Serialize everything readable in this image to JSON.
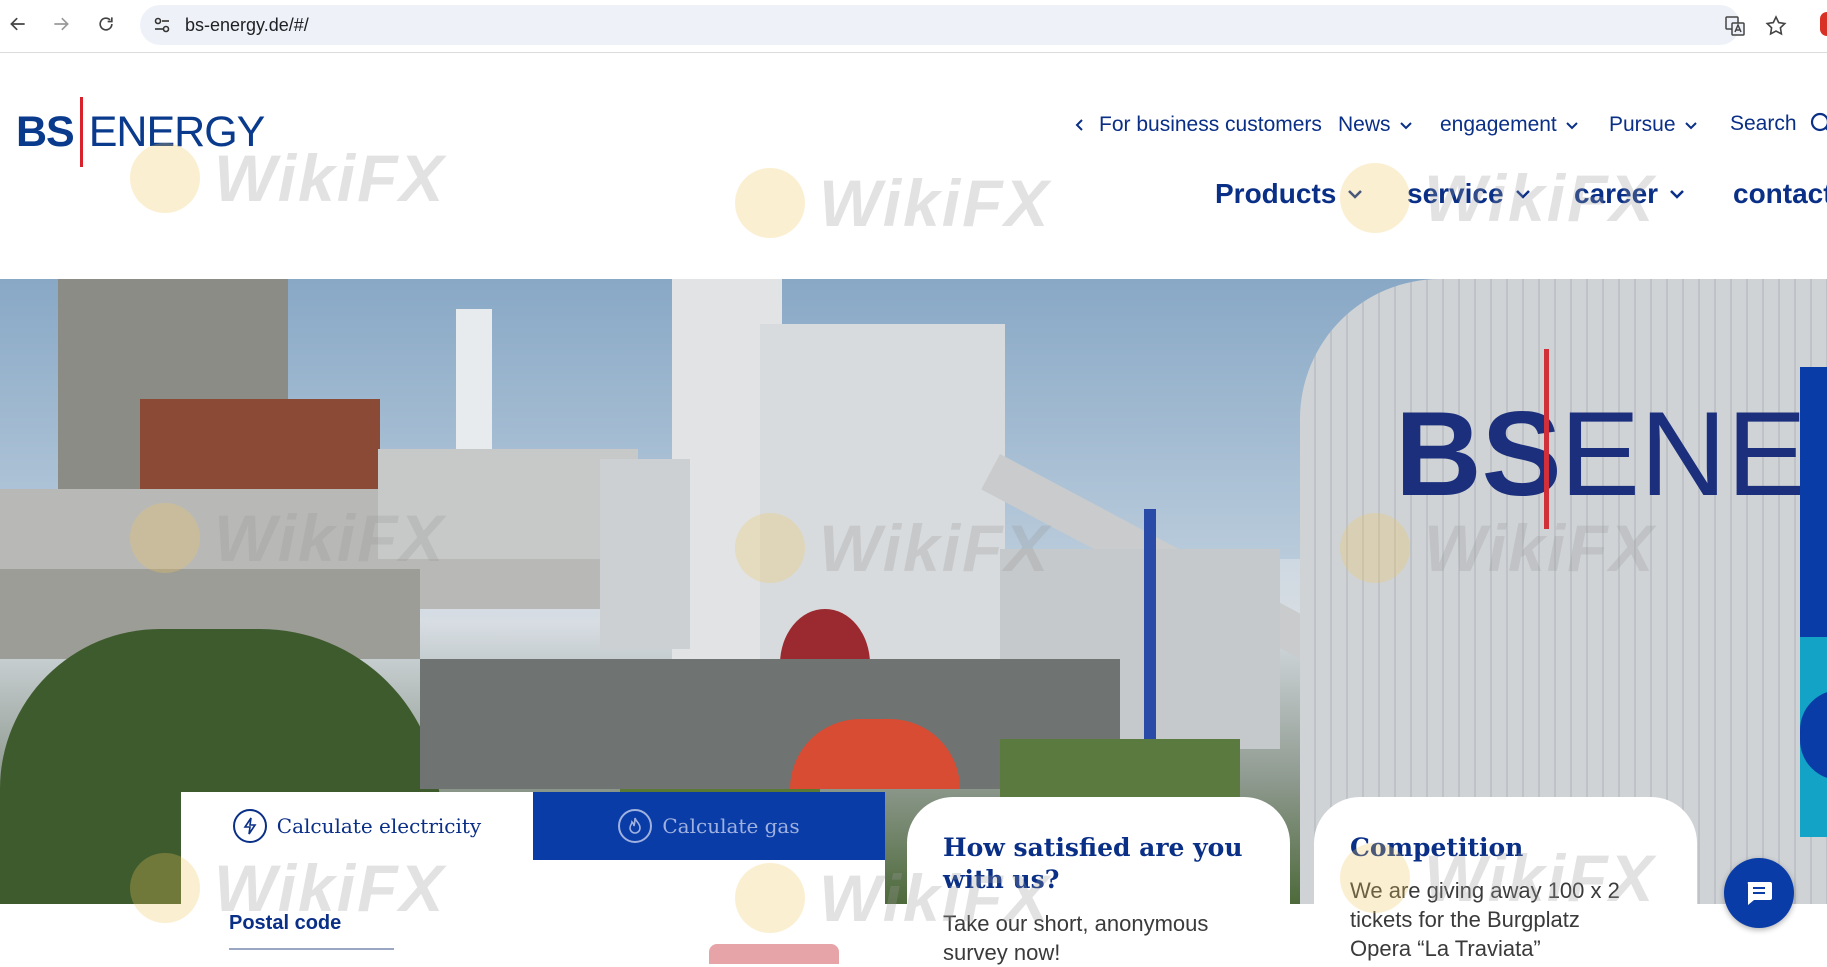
{
  "browser": {
    "url": "bs-energy.de/#/"
  },
  "brand": {
    "logo_bs": "BS",
    "logo_energy": "ENERGY",
    "primary_color": "#0a2f86",
    "accent_color": "#0a3ca8",
    "logo_red": "#d9212b"
  },
  "topnav": {
    "business": "For business customers",
    "news": "News",
    "engagement": "engagement",
    "pursue": "Pursue",
    "search": "Search"
  },
  "mainnav": {
    "products": "Products",
    "service": "service",
    "career": "career",
    "contact": "contact"
  },
  "hero": {
    "building_logo_bs": "BS",
    "building_logo_en": "ENE"
  },
  "calculator": {
    "tab_electricity": "Calculate electricity",
    "tab_gas": "Calculate gas",
    "postal_label": "Postal code"
  },
  "cards": {
    "survey_title": "How satisfied are you with us?",
    "survey_text_1": "Take our short, anonymous",
    "survey_text_2": "survey now!",
    "competition_title": "Competition",
    "competition_text_1": "We are giving away 100 x 2",
    "competition_text_2": "tickets for the Burgplatz",
    "competition_text_3": "Opera “La Traviata”"
  },
  "watermark": {
    "text": "WikiFX"
  }
}
